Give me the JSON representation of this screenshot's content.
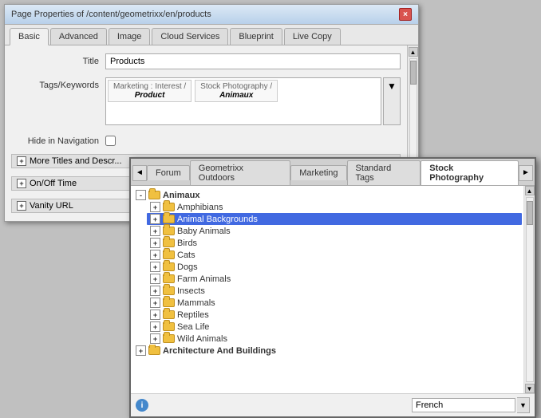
{
  "dialog": {
    "title": "Page Properties of /content/geometrixx/en/products",
    "close_btn_label": "×",
    "tabs": [
      {
        "id": "basic",
        "label": "Basic",
        "active": true
      },
      {
        "id": "advanced",
        "label": "Advanced",
        "active": false
      },
      {
        "id": "image",
        "label": "Image",
        "active": false
      },
      {
        "id": "cloud-services",
        "label": "Cloud Services",
        "active": false
      },
      {
        "id": "blueprint",
        "label": "Blueprint",
        "active": false
      },
      {
        "id": "live-copy",
        "label": "Live Copy",
        "active": false
      }
    ],
    "fields": {
      "title_label": "Title",
      "title_value": "Products",
      "tags_label": "Tags/Keywords",
      "tag1_line1": "Marketing : Interest /",
      "tag1_line2": "Product",
      "tag2_line1": "Stock Photography /",
      "tag2_line2": "Animaux",
      "hide_nav_label": "Hide in Navigation",
      "more_titles_label": "More Titles and Descr...",
      "on_off_label": "On/Off Time",
      "vanity_label": "Vanity URL"
    }
  },
  "tag_browser": {
    "nav_prev": "◄",
    "nav_next": "►",
    "tabs": [
      {
        "id": "forum",
        "label": "Forum",
        "active": false
      },
      {
        "id": "geometrixx",
        "label": "Geometrixx Outdoors",
        "active": false
      },
      {
        "id": "marketing",
        "label": "Marketing",
        "active": false
      },
      {
        "id": "standard-tags",
        "label": "Standard Tags",
        "active": false
      },
      {
        "id": "stock-photography",
        "label": "Stock Photography",
        "active": true
      }
    ],
    "tree": [
      {
        "level": "root",
        "label": "Animaux",
        "expanded": true
      },
      {
        "level": "child",
        "label": "Amphibians",
        "expanded": false
      },
      {
        "level": "child",
        "label": "Animal Backgrounds",
        "expanded": false,
        "highlighted": true
      },
      {
        "level": "child",
        "label": "Baby Animals",
        "expanded": false
      },
      {
        "level": "child",
        "label": "Birds",
        "expanded": false
      },
      {
        "level": "child",
        "label": "Cats",
        "expanded": false
      },
      {
        "level": "child",
        "label": "Dogs",
        "expanded": false
      },
      {
        "level": "child",
        "label": "Farm Animals",
        "expanded": false
      },
      {
        "level": "child",
        "label": "Insects",
        "expanded": false
      },
      {
        "level": "child",
        "label": "Mammals",
        "expanded": false
      },
      {
        "level": "child",
        "label": "Reptiles",
        "expanded": false
      },
      {
        "level": "child",
        "label": "Sea Life",
        "expanded": false
      },
      {
        "level": "child",
        "label": "Wild Animals",
        "expanded": false
      },
      {
        "level": "root",
        "label": "Architecture And Buildings",
        "expanded": false
      }
    ],
    "footer": {
      "icon_label": "i",
      "language_label": "French",
      "select_arrow": "▼"
    }
  }
}
